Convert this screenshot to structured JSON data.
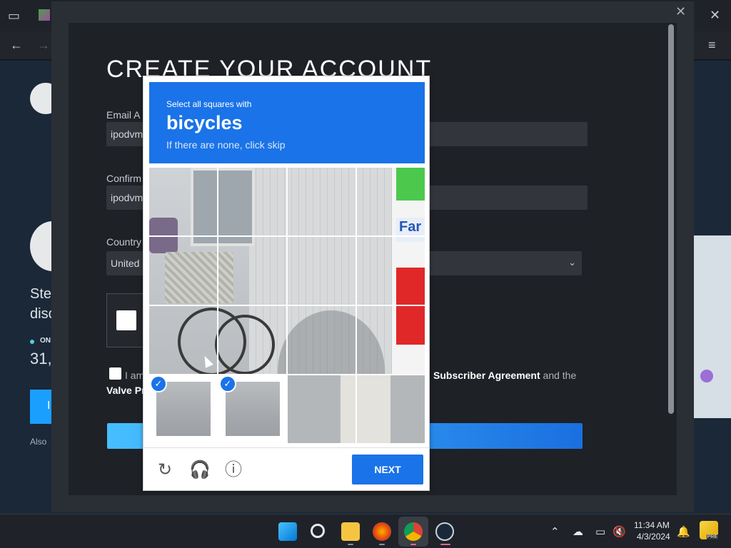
{
  "browser": {
    "back_icon": "arrow-left-icon",
    "forward_icon": "arrow-right-icon",
    "menu_icon": "hamburger-icon",
    "close_icon": "close-icon"
  },
  "background_page": {
    "text1": "Ste",
    "text2": "disc",
    "online_label": "ON",
    "online_count": "31,",
    "button_label": "I",
    "also_text": "Also"
  },
  "modal": {
    "title": "CREATE YOUR ACCOUNT",
    "email_label": "Email A",
    "email_value": "ipodvm",
    "confirm_label": "Confirm",
    "confirm_value": "ipodvm",
    "country_label": "Country",
    "country_value": "United",
    "agree_prefix": "I am",
    "agree_link": "Subscriber Agreement",
    "agree_suffix": "and the",
    "valve_privacy": "Valve Pr"
  },
  "recaptcha": {
    "instruction_small": "Select all squares with",
    "target": "bicycles",
    "hint": "If there are none, click skip",
    "next_label": "NEXT",
    "scene_sign_text": "Far",
    "selected_tiles": [
      "row4-col1",
      "row4-col2"
    ],
    "accent_color": "#1a73e8"
  },
  "taskbar": {
    "time": "11:34 AM",
    "date": "4/3/2024",
    "pre_badge": "PRE"
  }
}
